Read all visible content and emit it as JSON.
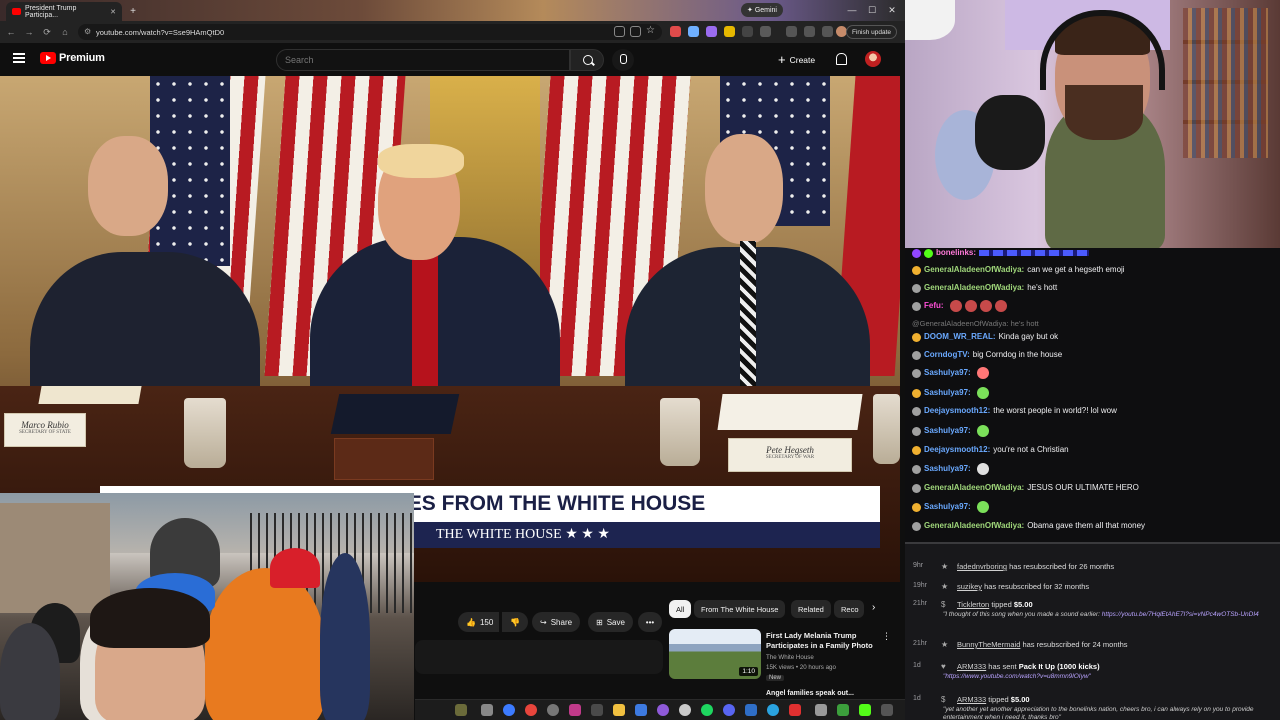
{
  "browser": {
    "tab_title": "President Trump Participa...",
    "gemini_label": "Gemini",
    "url": "youtube.com/watch?v=Sse9HAmQtD0",
    "finish_update": "Finish update"
  },
  "youtube": {
    "brand": "Premium",
    "search_placeholder": "Search",
    "create_label": "Create"
  },
  "video": {
    "nameplate_left": "Marco Rubio",
    "nameplate_left_sub": "SECRETARY OF STATE",
    "nameplate_right": "Pete Hegseth",
    "nameplate_right_sub": "SECRETARY OF WAR",
    "banner_main": "R UPDATES FROM THE WHITE HOUSE",
    "banner_sub": "THE WHITE HOUSE  ★ ★ ★",
    "like_count": "150",
    "share_label": "Share",
    "save_label": "Save",
    "more_label": "•••"
  },
  "chips": [
    "All",
    "From The White House",
    "Related",
    "Reco"
  ],
  "recommendation": {
    "title_line1": "First Lady Melania Trump",
    "title_line2": "Participates in a Family Photo",
    "channel": "The White House",
    "meta": "15K views • 20 hours ago",
    "badge": "New",
    "duration": "1:10",
    "next_title": "Angel families speak out..."
  },
  "chat": {
    "top_user": "bonelinks:",
    "messages": [
      {
        "user": "GeneralAladeenOfWadiya:",
        "text": "can we get a hegseth emoji",
        "color": "#9fd67a"
      },
      {
        "user": "GeneralAladeenOfWadiya:",
        "text": "he's hott",
        "color": "#9fd67a"
      },
      {
        "user": "Fefu:",
        "text": "",
        "color": "#ff4fd8"
      },
      {
        "user": "DOOM_WR_REAL:",
        "text": "Kinda gay but ok",
        "color": "#6aa9ff"
      },
      {
        "user": "CorndogTV:",
        "text": "big Corndog in the house",
        "color": "#6aa9ff"
      },
      {
        "user": "Sashulya97:",
        "text": "",
        "color": "#6aa9ff"
      },
      {
        "user": "Sashulya97:",
        "text": "",
        "color": "#6aa9ff"
      },
      {
        "user": "Deejaysmooth12:",
        "text": "the worst people in world?! lol wow",
        "color": "#6aa9ff"
      },
      {
        "user": "Sashulya97:",
        "text": "",
        "color": "#6aa9ff"
      },
      {
        "user": "Deejaysmooth12:",
        "text": "you're not a Christian",
        "color": "#6aa9ff"
      },
      {
        "user": "Sashulya97:",
        "text": "",
        "color": "#6aa9ff"
      },
      {
        "user": "GeneralAladeenOfWadiya:",
        "text": "JESUS OUR ULTIMATE HERO",
        "color": "#9fd67a"
      },
      {
        "user": "Sashulya97:",
        "text": "",
        "color": "#6aa9ff"
      },
      {
        "user": "GeneralAladeenOfWadiya:",
        "text": "Obama gave them all that money",
        "color": "#9fd67a"
      }
    ],
    "reply_to": "@GeneralAladeenOfWadiya: he's hott"
  },
  "alerts": [
    {
      "time": "9hr",
      "name": "fadednvrboring",
      "text": " has resubscribed for 26 months"
    },
    {
      "time": "19hr",
      "name": "suzikey",
      "text": " has resubscribed for 32 months"
    },
    {
      "time": "21hr",
      "name": "Ticklerton",
      "text": " tipped ",
      "amount": "$5.00",
      "message": "\"I thought of this song when you made a sound earlier: ",
      "link": "https://youtu.be/7HqlEtAhE7I?si=vNPc4wOTSb-UnDI4"
    },
    {
      "time": "21hr",
      "name": "BunnyTheMermaid",
      "text": " has resubscribed for 24 months"
    },
    {
      "time": "1d",
      "name": "ARM333",
      "text": " has sent ",
      "amount": "Pack It Up (1000 kicks)",
      "link": "\"https://www.youtube.com/watch?v=u8mmn9lOIyw\""
    },
    {
      "time": "1d",
      "name": "ARM333",
      "text": " tipped ",
      "amount": "$5.00",
      "message": "\"yet another yet another appreciation to the bonelinks nation, cheers bro, i can always rely on you to provide entertainment when i need it, thanks bro\""
    }
  ]
}
